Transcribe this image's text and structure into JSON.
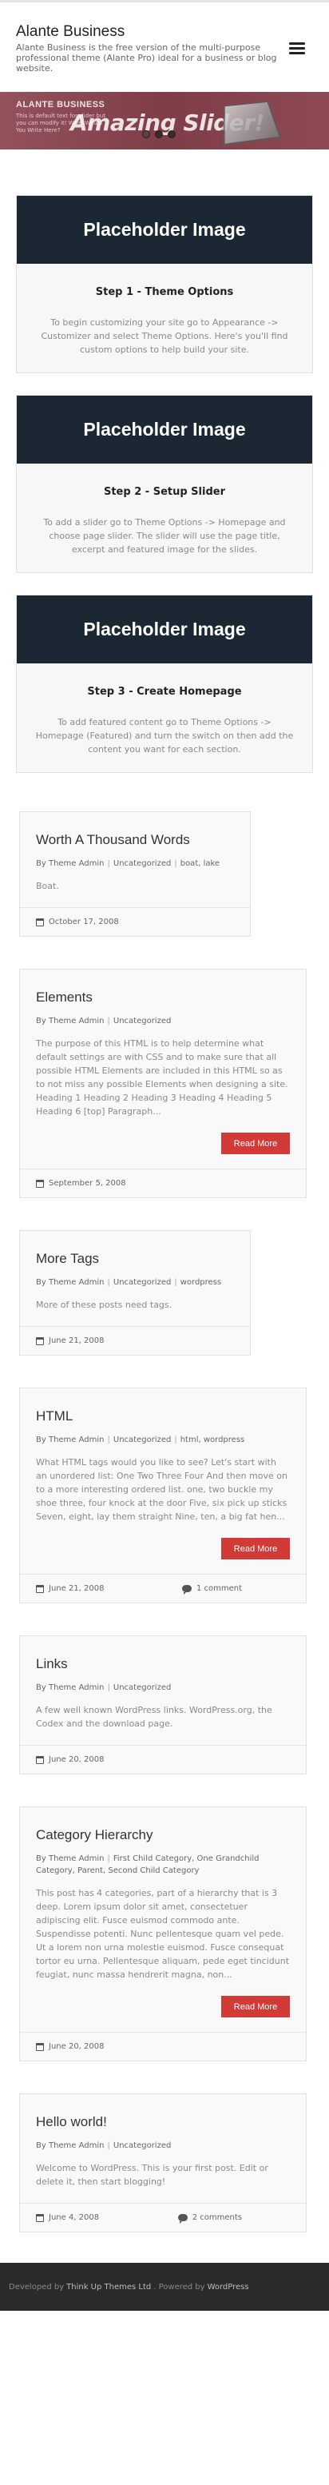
{
  "site": {
    "title": "Alante Business",
    "description": "Alante Business is the free version of the multi-purpose professional theme (Alante Pro) ideal for a business or blog website."
  },
  "slider": {
    "title": "ALANTE BUSINESS",
    "subtitle": "This is default text for slider but you can modify it! What Would You Write Here?",
    "big_text": "Amazing Slider!"
  },
  "features": [
    {
      "image_label": "Placeholder Image",
      "title": "Step 1 - Theme Options",
      "text": "To begin customizing your site go to Appearance -> Customizer and select Theme Options. Here's you'll find custom options to help build your site."
    },
    {
      "image_label": "Placeholder Image",
      "title": "Step 2 - Setup Slider",
      "text": "To add a slider go to Theme Options -> Homepage and choose page slider. The slider will use the page title, excerpt and featured image for the slides."
    },
    {
      "image_label": "Placeholder Image",
      "title": "Step 3 - Create Homepage",
      "text": "To add featured content go to Theme Options -> Homepage (Featured) and turn the switch on then add the content you want for each section."
    }
  ],
  "posts": [
    {
      "title": "Worth A Thousand Words",
      "author": "By Theme Admin",
      "cats": "Uncategorized",
      "tags": "boat, lake",
      "excerpt": "Boat.",
      "readmore": "",
      "date": "October 17, 2008",
      "comments": ""
    },
    {
      "title": "Elements",
      "author": "By Theme Admin",
      "cats": "Uncategorized",
      "tags": "",
      "excerpt": "The purpose of this HTML is to help determine what default settings are with CSS and to make sure that all possible HTML Elements are included in this HTML so as to not miss any possible Elements when designing a site. Heading 1 Heading 2 Heading 3 Heading 4 Heading 5 Heading 6 [top] Paragraph...",
      "readmore": "Read More",
      "date": "September 5, 2008",
      "comments": ""
    },
    {
      "title": "More Tags",
      "author": "By Theme Admin",
      "cats": "Uncategorized",
      "tags": "wordpress",
      "excerpt": "More of these posts need tags.",
      "readmore": "",
      "date": "June 21, 2008",
      "comments": ""
    },
    {
      "title": "HTML",
      "author": "By Theme Admin",
      "cats": "Uncategorized",
      "tags": "html, wordpress",
      "excerpt": "What HTML tags would you like to see? Let's start with an unordered list: One Two Three Four And then move on to a more interesting ordered list. one, two buckle my shoe three, four knock at the door Five, six pick up sticks Seven, eight, lay them straight Nine, ten, a big fat hen...",
      "readmore": "Read More",
      "date": "June 21, 2008",
      "comments": "1 comment"
    },
    {
      "title": "Links",
      "author": "By Theme Admin",
      "cats": "Uncategorized",
      "tags": "",
      "excerpt": "A few well known WordPress links. WordPress.org, the Codex and the download page.",
      "readmore": "",
      "date": "June 20, 2008",
      "comments": ""
    },
    {
      "title": "Category Hierarchy",
      "author": "By Theme Admin",
      "cats": "First Child Category, One Grandchild Category, Parent, Second Child Category",
      "tags": "",
      "excerpt": "This post has 4 categories, part of a hierarchy that is 3 deep. Lorem ipsum dolor sit amet, consectetuer adipiscing elit. Fusce euismod commodo ante. Suspendisse potenti. Nunc pellentesque quam vel pede. Ut a lorem non urna molestie euismod. Fusce consequat tortor eu urna. Pellentesque aliquam, pede eget tincidunt feugiat, nunc massa hendrerit magna, non...",
      "readmore": "Read More",
      "date": "June 20, 2008",
      "comments": ""
    },
    {
      "title": "Hello world!",
      "author": "By Theme Admin",
      "cats": "Uncategorized",
      "tags": "",
      "excerpt": "Welcome to WordPress. This is your first post. Edit or delete it, then start blogging!",
      "readmore": "",
      "date": "June 4, 2008",
      "comments": "2 comments"
    }
  ],
  "footer": {
    "developed_by": "Developed by",
    "developer": "Think Up Themes Ltd",
    "powered_by": ". Powered by",
    "platform": "WordPress"
  }
}
